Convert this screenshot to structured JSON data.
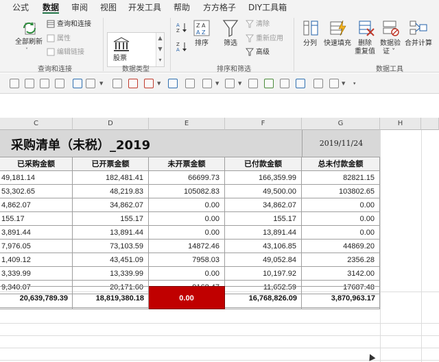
{
  "menu": {
    "tabs": [
      "公式",
      "数据",
      "审阅",
      "视图",
      "开发工具",
      "帮助",
      "方方格子",
      "DIY工具箱"
    ],
    "active_tab": "数据"
  },
  "ribbon": {
    "query_group": {
      "refresh_all": "全部刷新",
      "queries_connections": "查询和连接",
      "properties": "属性",
      "edit_links": "编辑链接",
      "group_label": "查询和连接"
    },
    "datatype_group": {
      "stocks": "股票",
      "group_label": "数据类型"
    },
    "sort_filter_group": {
      "sort": "排序",
      "filter": "筛选",
      "clear": "清除",
      "reapply": "重新应用",
      "advanced": "高级",
      "group_label": "排序和筛选"
    },
    "data_tools_group": {
      "text_to_columns": "分列",
      "flash_fill": "快速填充",
      "remove_duplicates_1": "删除",
      "remove_duplicates_2": "重复值",
      "data_validation_1": "数据验",
      "data_validation_2": "证 ˅",
      "consolidate": "合并计算",
      "group_label": "数据工具"
    }
  },
  "sheet": {
    "column_headers": [
      "C",
      "D",
      "E",
      "F",
      "G",
      "H"
    ],
    "title": "采购清单（未税）_2019",
    "date": "2019/11/24",
    "table_headers": [
      "已采购金额",
      "已开票金额",
      "未开票金额",
      "已付款金额",
      "总未付款金额"
    ],
    "rows": [
      [
        "49,181.14",
        "182,481.41",
        "66699.73",
        "166,359.99",
        "82821.15"
      ],
      [
        "53,302.65",
        "48,219.83",
        "105082.83",
        "49,500.00",
        "103802.65"
      ],
      [
        "4,862.07",
        "34,862.07",
        "0.00",
        "34,862.07",
        "0.00"
      ],
      [
        "155.17",
        "155.17",
        "0.00",
        "155.17",
        "0.00"
      ],
      [
        "3,891.44",
        "13,891.44",
        "0.00",
        "13,891.44",
        "0.00"
      ],
      [
        "7,976.05",
        "73,103.59",
        "14872.46",
        "43,106.85",
        "44869.20"
      ],
      [
        "1,409.12",
        "43,451.09",
        "7958.03",
        "49,052.84",
        "2356.28"
      ],
      [
        "3,339.99",
        "13,339.99",
        "0.00",
        "10,197.92",
        "3142.00"
      ],
      [
        "9,340.07",
        "20,171.60",
        "9168.47",
        "11,652.59",
        "17687.48"
      ]
    ],
    "totals": [
      "20,639,789.39",
      "18,819,380.18",
      "0.00",
      "16,768,826.09",
      "3,870,963.17"
    ],
    "highlight_color": "#c00000",
    "accent_color": "#217346"
  }
}
